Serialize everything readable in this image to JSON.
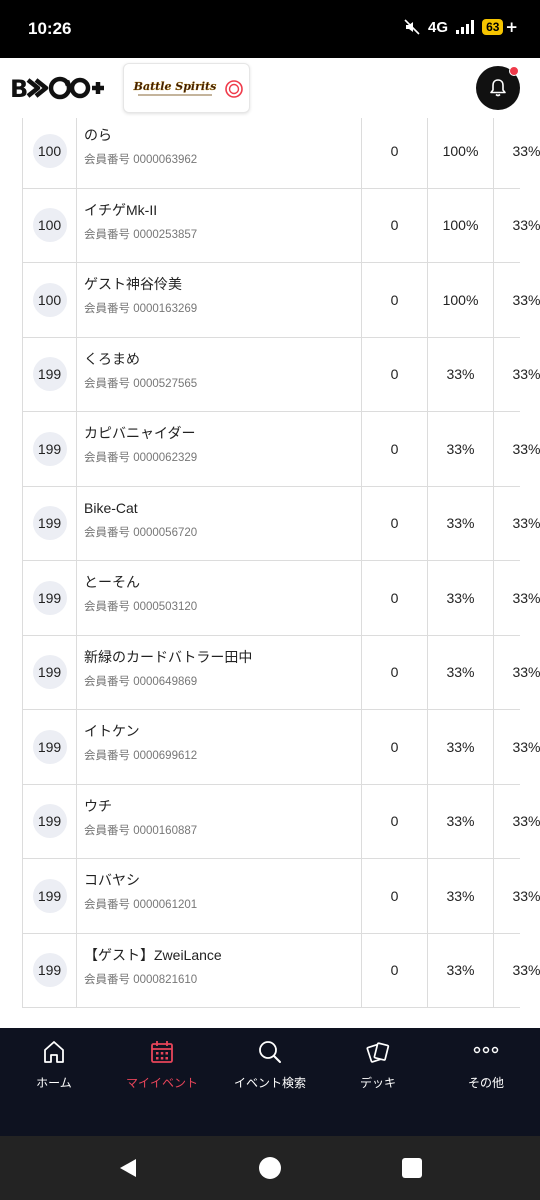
{
  "status_bar": {
    "time": "10:26",
    "network": "4G",
    "battery": "63",
    "battery_suffix": "+"
  },
  "header": {
    "logo_text": "B",
    "game_logo_text": "Battle Spirits",
    "accent_color": "#ef3a4a"
  },
  "table": {
    "rows": [
      {
        "rank": "100",
        "name": "のら",
        "member_no": "会員番号 0000063962",
        "points": "0",
        "pct1": "100%",
        "pct2": "33%"
      },
      {
        "rank": "100",
        "name": "イチゲMk-II",
        "member_no": "会員番号 0000253857",
        "points": "0",
        "pct1": "100%",
        "pct2": "33%"
      },
      {
        "rank": "100",
        "name": "ゲスト神谷伶美",
        "member_no": "会員番号 0000163269",
        "points": "0",
        "pct1": "100%",
        "pct2": "33%"
      },
      {
        "rank": "199",
        "name": "くろまめ",
        "member_no": "会員番号 0000527565",
        "points": "0",
        "pct1": "33%",
        "pct2": "33%"
      },
      {
        "rank": "199",
        "name": "カピバニャイダー",
        "member_no": "会員番号 0000062329",
        "points": "0",
        "pct1": "33%",
        "pct2": "33%"
      },
      {
        "rank": "199",
        "name": "Bike-Cat",
        "member_no": "会員番号 0000056720",
        "points": "0",
        "pct1": "33%",
        "pct2": "33%"
      },
      {
        "rank": "199",
        "name": "とーそん",
        "member_no": "会員番号 0000503120",
        "points": "0",
        "pct1": "33%",
        "pct2": "33%"
      },
      {
        "rank": "199",
        "name": "新緑のカードバトラー田中",
        "member_no": "会員番号 0000649869",
        "points": "0",
        "pct1": "33%",
        "pct2": "33%"
      },
      {
        "rank": "199",
        "name": "イトケン",
        "member_no": "会員番号 0000699612",
        "points": "0",
        "pct1": "33%",
        "pct2": "33%"
      },
      {
        "rank": "199",
        "name": "ウチ",
        "member_no": "会員番号 0000160887",
        "points": "0",
        "pct1": "33%",
        "pct2": "33%"
      },
      {
        "rank": "199",
        "name": "コバヤシ",
        "member_no": "会員番号 0000061201",
        "points": "0",
        "pct1": "33%",
        "pct2": "33%"
      },
      {
        "rank": "199",
        "name": "【ゲスト】ZweiLance",
        "member_no": "会員番号 0000821610",
        "points": "0",
        "pct1": "33%",
        "pct2": "33%"
      }
    ]
  },
  "bottom_nav": {
    "items": [
      {
        "label": "ホーム",
        "icon": "home-icon"
      },
      {
        "label": "マイイベント",
        "icon": "calendar-icon",
        "active": true
      },
      {
        "label": "イベント検索",
        "icon": "search-icon"
      },
      {
        "label": "デッキ",
        "icon": "cards-icon"
      },
      {
        "label": "その他",
        "icon": "more-icon"
      }
    ],
    "active_color": "#e8455a"
  }
}
